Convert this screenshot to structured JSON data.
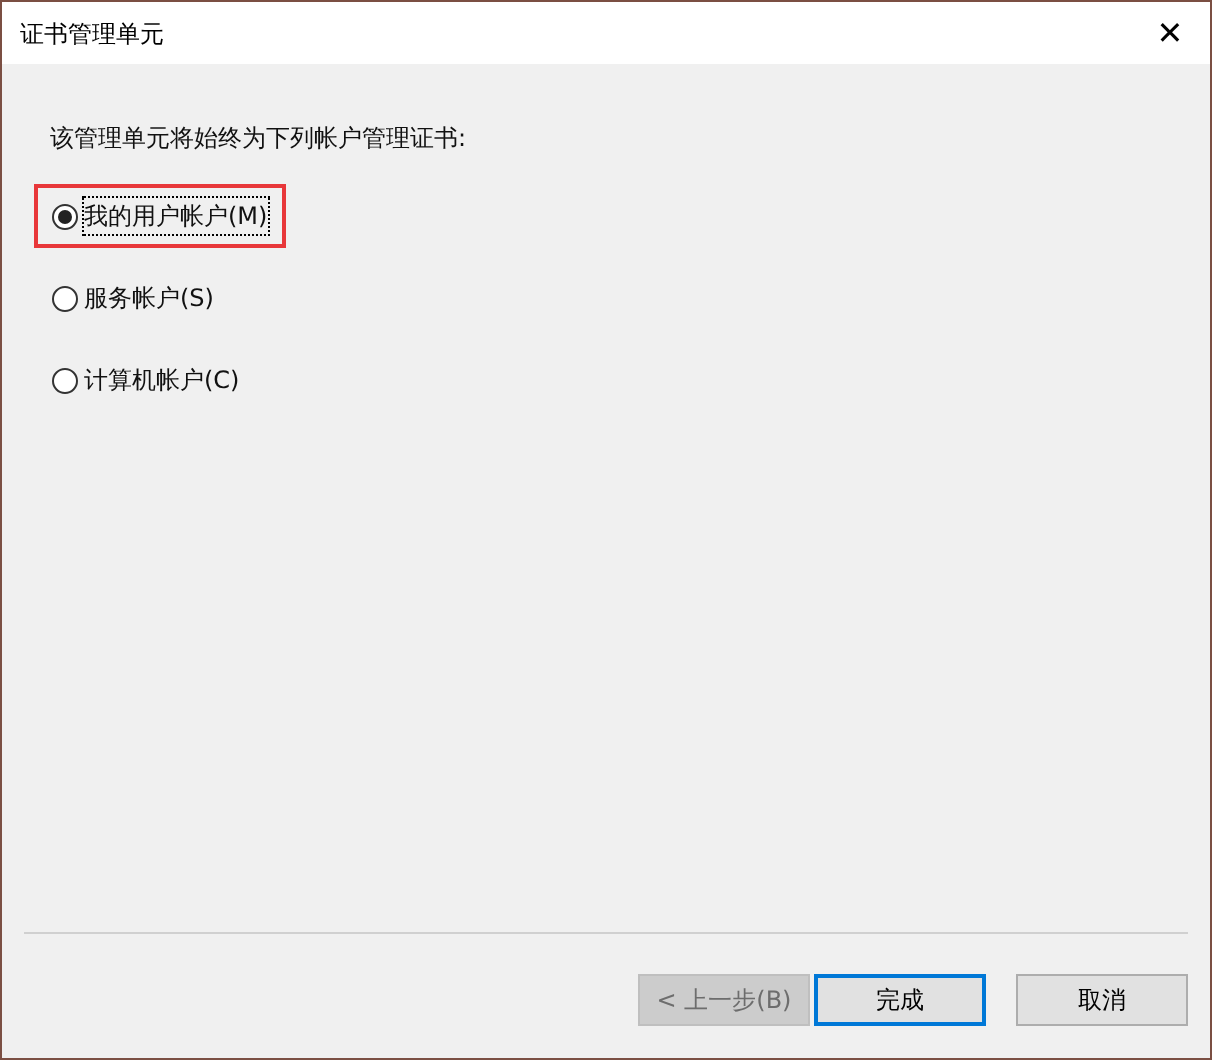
{
  "window": {
    "title": "证书管理单元",
    "close": "✕"
  },
  "instruction": "该管理单元将始终为下列帐户管理证书:",
  "options": [
    {
      "label": "我的用户帐户(M)",
      "selected": true,
      "highlighted": true
    },
    {
      "label": "服务帐户(S)",
      "selected": false,
      "highlighted": false
    },
    {
      "label": "计算机帐户(C)",
      "selected": false,
      "highlighted": false
    }
  ],
  "buttons": [
    {
      "label": "< 上一步(B)",
      "disabled": true,
      "default": false
    },
    {
      "label": "完成",
      "disabled": false,
      "default": true
    },
    {
      "label": "取消",
      "disabled": false,
      "default": false
    }
  ]
}
